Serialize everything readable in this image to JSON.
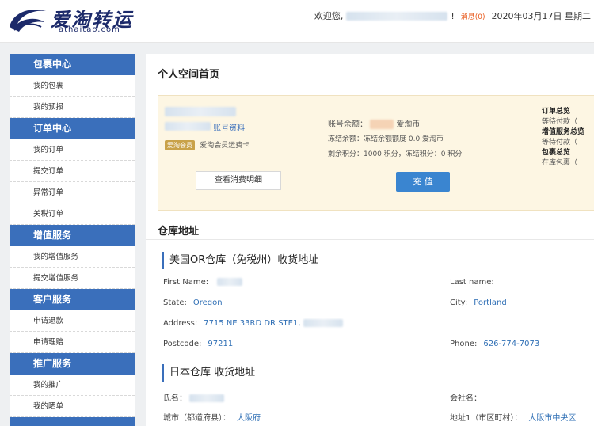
{
  "header": {
    "logo_cn": "爱淘转运",
    "logo_en": "athaitao.com",
    "welcome": "欢迎您,",
    "exclaim": "!",
    "messages": "消息(0)",
    "date": "2020年03月17日 星期二"
  },
  "sidebar": [
    {
      "title": "包裹中心",
      "items": [
        "我的包裹",
        "我的预报"
      ]
    },
    {
      "title": "订单中心",
      "items": [
        "我的订单",
        "提交订单",
        "异常订单",
        "关税订单"
      ]
    },
    {
      "title": "增值服务",
      "items": [
        "我的增值服务",
        "提交增值服务"
      ]
    },
    {
      "title": "客户服务",
      "items": [
        "申请退款",
        "申请理赔"
      ]
    },
    {
      "title": "推广服务",
      "items": [
        "我的推广",
        "我的晒单"
      ]
    }
  ],
  "main": {
    "page_title": "个人空间首页",
    "account": {
      "card_suffix": "账号资料",
      "vip_badge": "爱淘会员",
      "vip_text": "爱淘会员运费卡",
      "detail_button": "查看消费明细",
      "balance_label": "账号余额：",
      "balance_unit": "爱淘币",
      "frozen": "冻结余额：冻结余额额度 0.0 爱淘币",
      "points": "剩余积分：1000 积分，冻结积分：0 积分",
      "recharge_button": "充 值"
    },
    "summary": {
      "order_title": "订单总览",
      "order_pending": "等待付款（",
      "vas_title": "增值服务总览",
      "vas_pending": "等待付款（",
      "parcel_title": "包裹总览",
      "parcel_pending": "在库包裹（"
    },
    "warehouse_title": "仓库地址",
    "us": {
      "title": "美国OR仓库（免税州）收货地址",
      "first_name_label": "First Name:",
      "last_name_label": "Last name:",
      "state_label": "State:",
      "state": "Oregon",
      "city_label": "City:",
      "city": "Portland",
      "address_label": "Address:",
      "address": "7715 NE 33RD DR STE1,",
      "postcode_label": "Postcode:",
      "postcode": "97211",
      "phone_label": "Phone:",
      "phone": "626-774-7073"
    },
    "jp": {
      "title": "日本仓库 收货地址",
      "name_label": "氏名：",
      "company_label": "会社名：",
      "pref_label": "城市（都道府县）：",
      "pref": "大阪府",
      "addr1_label": "地址1（市区町村）：",
      "addr1": "大阪市中央区"
    }
  }
}
